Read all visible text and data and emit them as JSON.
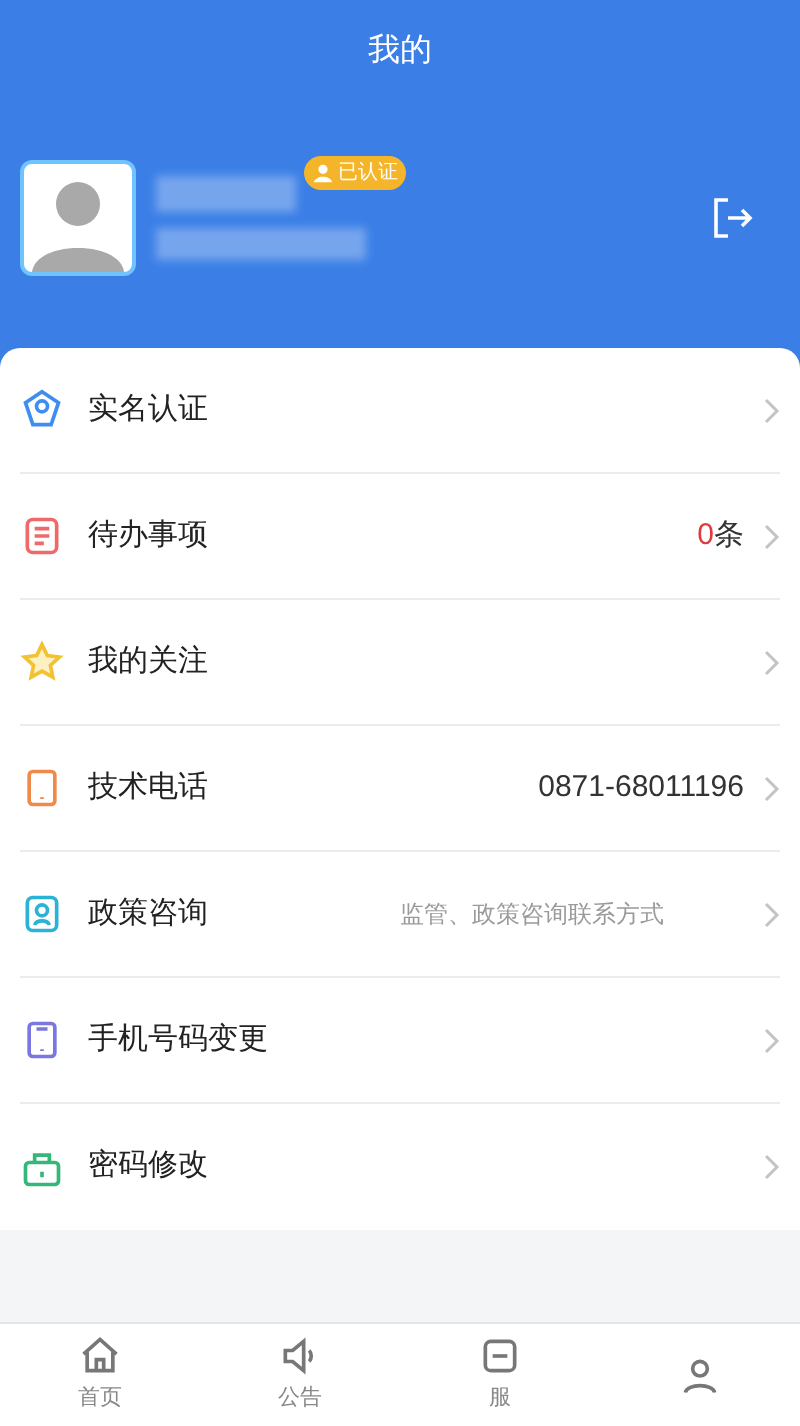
{
  "header": {
    "title": "我的"
  },
  "profile": {
    "badge": "已认证"
  },
  "menu": [
    {
      "label": "实名认证"
    },
    {
      "label": "待办事项",
      "count": "0",
      "unit": "条"
    },
    {
      "label": "我的关注"
    },
    {
      "label": "技术电话",
      "value": "0871-68011196"
    },
    {
      "label": "政策咨询",
      "hint": "监管、政策咨询联系方式"
    },
    {
      "label": "手机号码变更"
    },
    {
      "label": "密码修改"
    }
  ],
  "tabbar": [
    {
      "label": "首页"
    },
    {
      "label": "公告"
    },
    {
      "label": "服"
    }
  ]
}
